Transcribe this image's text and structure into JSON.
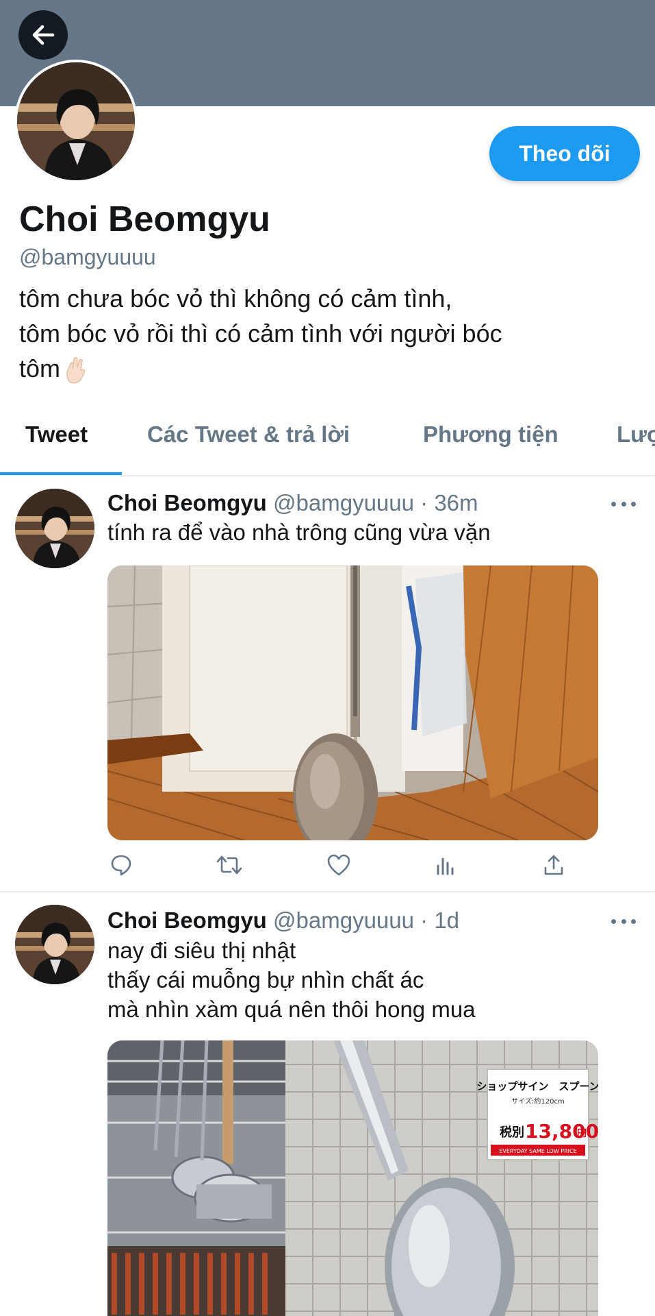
{
  "header": {
    "back_icon": "arrow-left-icon",
    "banner_color": "#66778a"
  },
  "profile": {
    "display_name": "Choi Beomgyu",
    "handle": "@bamgyuuuu",
    "follow_label": "Theo dõi",
    "bio_lines": [
      "tôm chưa bóc vỏ thì không có cảm tình,",
      "tôm bóc vỏ rồi thì có cảm tình với người bóc",
      "tôm"
    ],
    "bio_emoji": "hand-emoji"
  },
  "tabs": [
    {
      "label": "Tweet",
      "active": true
    },
    {
      "label": "Các Tweet & trả lời",
      "active": false
    },
    {
      "label": "Phương tiện",
      "active": false
    },
    {
      "label": "Lượt thích",
      "active": false
    }
  ],
  "tweets": [
    {
      "name": "Choi Beomgyu",
      "handle": "@bamgyuuuu",
      "time": "36m",
      "lines": [
        "tính ra để vào nhà trông cũng vừa vặn"
      ],
      "media": "photo-giant-ladle-at-doorway"
    },
    {
      "name": "Choi Beomgyu",
      "handle": "@bamgyuuuu",
      "time": "1d",
      "lines": [
        "nay đi siêu thị nhật",
        "thấy cái muỗng bự nhìn chất ác",
        "mà nhìn xàm quá nên thôi hong mua"
      ],
      "media": "photo-giant-spoon-in-store",
      "sign_text": {
        "line1": "ショップサイン　スプーン",
        "line2": "サイズ:約120cm",
        "tax_label": "税別",
        "price": "13,800",
        "yen": "円",
        "footer": "EVERYDAY SAME LOW PRICE"
      }
    }
  ],
  "actions": [
    "reply-icon",
    "retweet-icon",
    "like-icon",
    "analytics-icon",
    "share-icon"
  ],
  "colors": {
    "accent": "#1d9bf0",
    "secondary_text": "#657786",
    "divider": "#e6ecf0"
  }
}
